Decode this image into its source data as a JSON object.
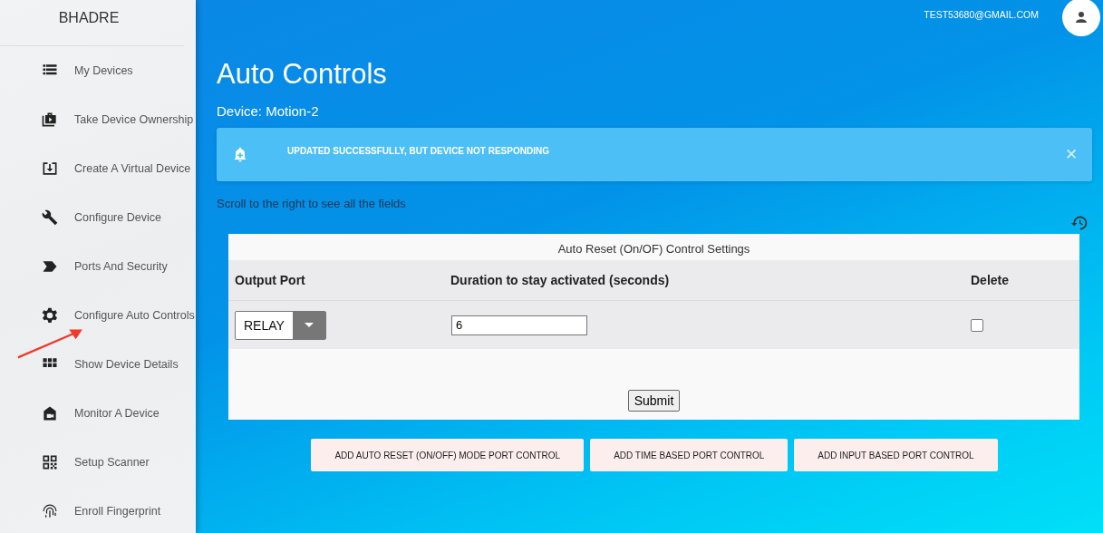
{
  "sidebar": {
    "brand": "BHADRE",
    "items": [
      {
        "label": "My Devices"
      },
      {
        "label": "Take Device Ownership"
      },
      {
        "label": "Create A Virtual Device"
      },
      {
        "label": "Configure Device"
      },
      {
        "label": "Ports And Security"
      },
      {
        "label": "Configure Auto Controls"
      },
      {
        "label": "Show Device Details"
      },
      {
        "label": "Monitor A Device"
      },
      {
        "label": "Setup Scanner"
      },
      {
        "label": "Enroll Fingerprint"
      }
    ]
  },
  "user": {
    "email": "TEST53680@GMAIL.COM"
  },
  "page": {
    "title": "Auto Controls",
    "device": "Device: Motion-2"
  },
  "alert": {
    "message": "UPDATED SUCCESSFULLY, BUT DEVICE NOT RESPONDING",
    "close": "✕"
  },
  "hint": "Scroll to the right to see all the fields",
  "table": {
    "title": "Auto Reset (On/OF) Control Settings",
    "columns": [
      "Output Port",
      "Duration to stay activated (seconds)",
      "Delete"
    ],
    "rows": [
      {
        "output_port": "RELAY",
        "duration": "6",
        "delete": false
      }
    ]
  },
  "submit": "Submit",
  "add_buttons": [
    "ADD AUTO RESET (ON/OFF) MODE PORT CONTROL",
    "ADD TIME BASED PORT CONTROL",
    "ADD INPUT BASED PORT CONTROL"
  ]
}
